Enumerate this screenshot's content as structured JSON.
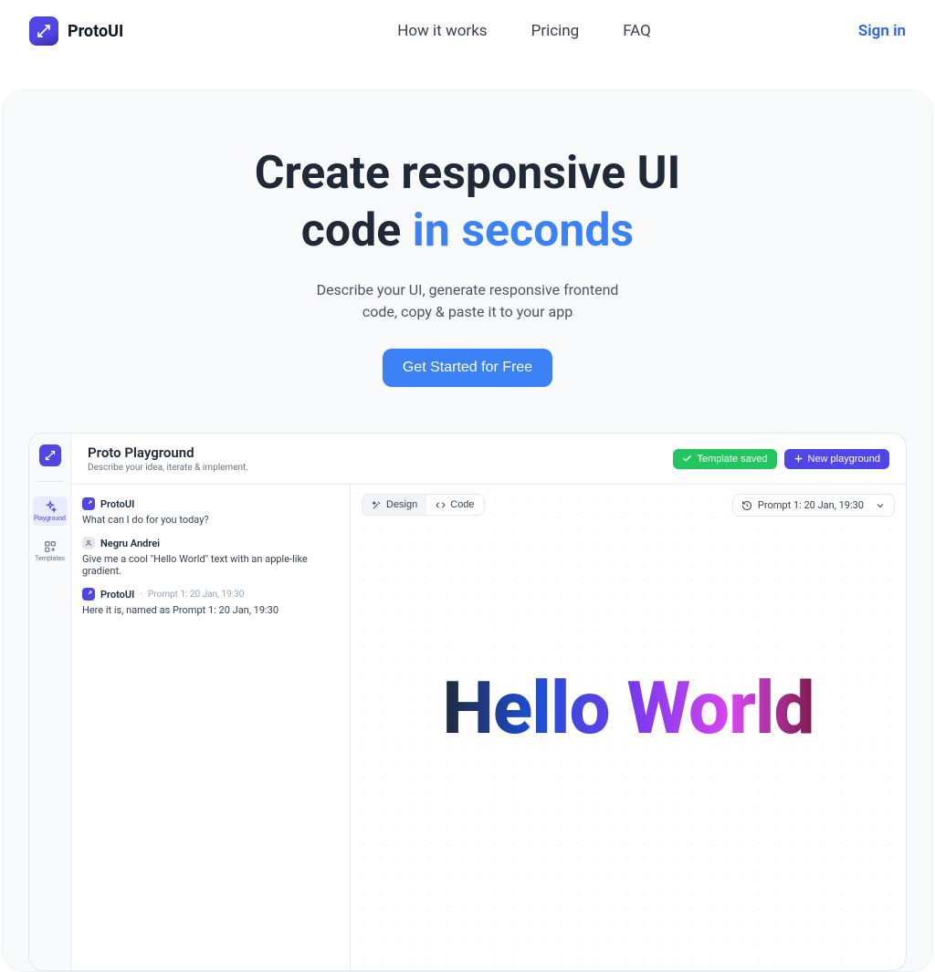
{
  "header": {
    "brand": "ProtoUI",
    "nav": {
      "how": "How it works",
      "pricing": "Pricing",
      "faq": "FAQ"
    },
    "signin": "Sign in"
  },
  "hero": {
    "title_a": "Create responsive UI",
    "title_b": "code",
    "title_accent": "in seconds",
    "subtitle_a": "Describe your UI, generate responsive frontend",
    "subtitle_b": "code, copy & paste it to your app",
    "cta": "Get Started for Free"
  },
  "sidebar": {
    "items": [
      {
        "label": "Playground"
      },
      {
        "label": "Templates"
      }
    ]
  },
  "topbar": {
    "title": "Proto Playground",
    "subtitle": "Describe your idea, iterate & implement.",
    "template_saved": "Template saved",
    "new_playground": "New playground"
  },
  "chat": {
    "m0": {
      "name": "ProtoUI",
      "body": "What can I do for you today?"
    },
    "m1": {
      "name": "Negru Andrei",
      "body": "Give me a cool \"Hello World\" text with an apple-like gradient."
    },
    "m2": {
      "name": "ProtoUI",
      "meta": "Prompt 1: 20 Jan, 19:30",
      "body": "Here it is, named as Prompt 1: 20 Jan, 19:30"
    }
  },
  "canvas": {
    "tab_design": "Design",
    "tab_code": "Code",
    "select_label": "Prompt 1: 20 Jan, 19:30",
    "hello": "Hello World"
  }
}
